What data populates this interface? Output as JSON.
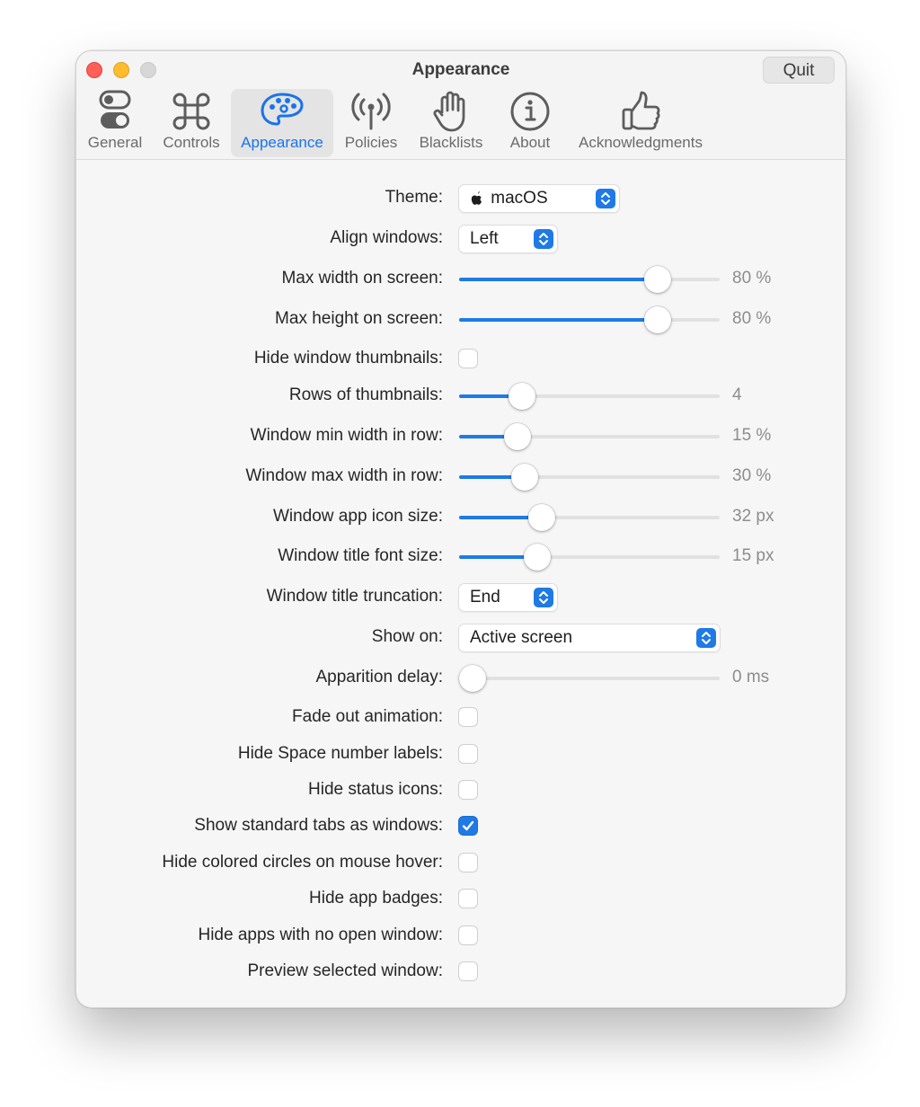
{
  "window": {
    "title": "Appearance",
    "quit_label": "Quit"
  },
  "tabs": [
    {
      "label": "General",
      "icon": "toggles-icon",
      "selected": false
    },
    {
      "label": "Controls",
      "icon": "command-key-icon",
      "selected": false
    },
    {
      "label": "Appearance",
      "icon": "palette-icon",
      "selected": true
    },
    {
      "label": "Policies",
      "icon": "antenna-icon",
      "selected": false
    },
    {
      "label": "Blacklists",
      "icon": "hand-stop-icon",
      "selected": false
    },
    {
      "label": "About",
      "icon": "info-circle-icon",
      "selected": false
    },
    {
      "label": "Acknowledgments",
      "icon": "thumbs-up-icon",
      "selected": false
    }
  ],
  "settings": {
    "theme": {
      "label": "Theme:",
      "value": "macOS",
      "icon": "apple-logo-icon"
    },
    "align_windows": {
      "label": "Align windows:",
      "value": "Left"
    },
    "max_width": {
      "label": "Max width on screen:",
      "value_text": "80 %",
      "fraction": 0.75
    },
    "max_height": {
      "label": "Max height on screen:",
      "value_text": "80 %",
      "fraction": 0.75
    },
    "hide_thumbnails": {
      "label": "Hide window thumbnails:",
      "checked": false
    },
    "rows_thumbnails": {
      "label": "Rows of thumbnails:",
      "value_text": "4",
      "fraction": 0.2
    },
    "min_width_row": {
      "label": "Window min width in row:",
      "value_text": "15 %",
      "fraction": 0.18
    },
    "max_width_row": {
      "label": "Window max width in row:",
      "value_text": "30 %",
      "fraction": 0.21
    },
    "app_icon_size": {
      "label": "Window app icon size:",
      "value_text": "32 px",
      "fraction": 0.28
    },
    "title_font_size": {
      "label": "Window title font size:",
      "value_text": "15 px",
      "fraction": 0.26
    },
    "title_truncation": {
      "label": "Window title truncation:",
      "value": "End"
    },
    "show_on": {
      "label": "Show on:",
      "value": "Active screen"
    },
    "apparition_delay": {
      "label": "Apparition delay:",
      "value_text": "0 ms",
      "fraction": 0.0
    },
    "fade_out": {
      "label": "Fade out animation:",
      "checked": false
    },
    "hide_space_labels": {
      "label": "Hide Space number labels:",
      "checked": false
    },
    "hide_status_icons": {
      "label": "Hide status icons:",
      "checked": false
    },
    "show_tabs_windows": {
      "label": "Show standard tabs as windows:",
      "checked": true
    },
    "hide_colored_circles": {
      "label": "Hide colored circles on mouse hover:",
      "checked": false
    },
    "hide_app_badges": {
      "label": "Hide app badges:",
      "checked": false
    },
    "hide_apps_no_window": {
      "label": "Hide apps with no open window:",
      "checked": false
    },
    "preview_selected": {
      "label": "Preview selected window:",
      "checked": false
    }
  },
  "colors": {
    "accent": "#1f7ae6",
    "traffic_close": "#fe5f57",
    "traffic_minimize": "#febc2e",
    "traffic_zoom_disabled": "#d7d7d7"
  }
}
